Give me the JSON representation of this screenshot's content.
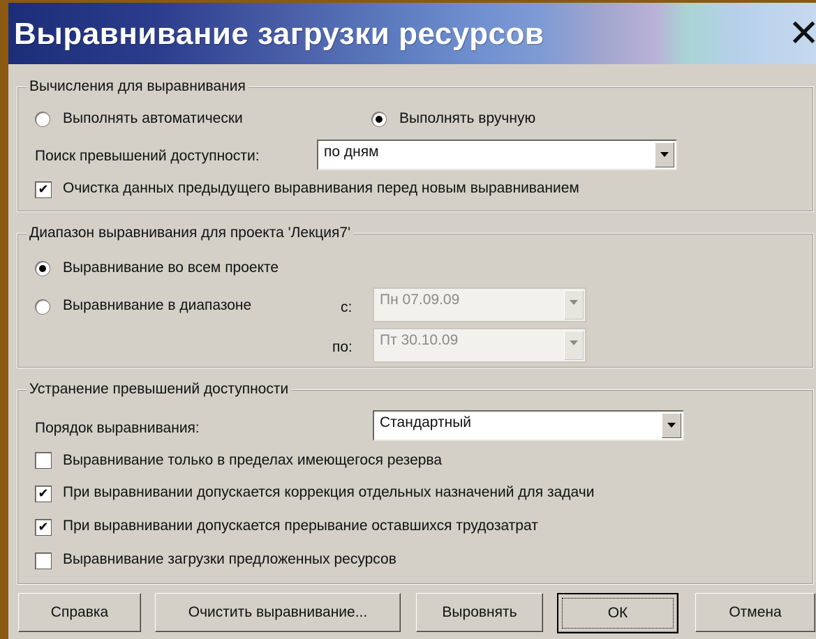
{
  "window": {
    "title": "Выравнивание загрузки ресурсов",
    "close_glyph": "✕"
  },
  "calc": {
    "legend": "Вычисления для выравнивания",
    "radio_auto": {
      "label": "Выполнять автоматически",
      "checked": false
    },
    "radio_manual": {
      "label": "Выполнять вручную",
      "checked": true
    },
    "search_label": "Поиск превышений доступности:",
    "search_value": "по дням",
    "clear_checkbox": {
      "label": "Очистка данных предыдущего выравнивания перед новым выравниванием",
      "checked": true
    }
  },
  "range": {
    "legend": "Диапазон выравнивания для проекта 'Лекция7'",
    "radio_whole": {
      "label": "Выравнивание во всем проекте",
      "checked": true
    },
    "radio_range": {
      "label": "Выравнивание в диапазоне",
      "checked": false
    },
    "from_label": "с:",
    "from_value": "Пн 07.09.09",
    "to_label": "по:",
    "to_value": "Пт 30.10.09"
  },
  "resolve": {
    "legend": "Устранение превышений доступности",
    "order_label": "Порядок выравнивания:",
    "order_value": "Стандартный",
    "checkboxes": [
      {
        "label": "Выравнивание только в пределах имеющегося резерва",
        "checked": false
      },
      {
        "label": "При выравнивании допускается коррекция отдельных назначений для задачи",
        "checked": true
      },
      {
        "label": "При выравнивании допускается прерывание оставшихся трудозатрат",
        "checked": true
      },
      {
        "label": "Выравнивание загрузки предложенных ресурсов",
        "checked": false
      }
    ]
  },
  "buttons": {
    "help": "Справка",
    "clear": "Очистить выравнивание...",
    "level": "Выровнять",
    "ok": "ОК",
    "cancel": "Отмена"
  },
  "check_glyph": "✔"
}
